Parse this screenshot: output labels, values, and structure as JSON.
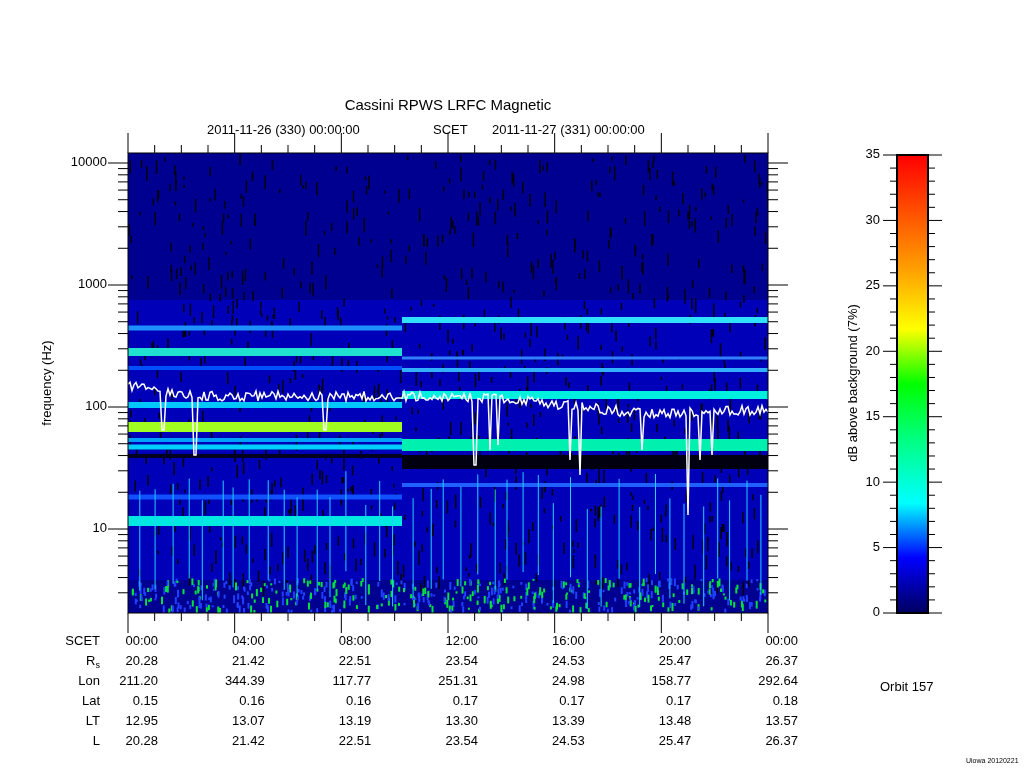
{
  "title": "Cassini RPWS LRFC Magnetic",
  "time_range": {
    "start": "2011-11-26 (330) 00:00:00",
    "label": "SCET",
    "end": "2011-11-27 (331) 00:00:00"
  },
  "y_axis": {
    "label": "frequency (Hz)",
    "ticks": [
      "10000",
      "1000",
      "100",
      "10"
    ]
  },
  "color_scale": {
    "label": "dB above background (7%)",
    "ticks": [
      "35",
      "30",
      "25",
      "20",
      "15",
      "10",
      "5",
      "0"
    ]
  },
  "ephemeris": [
    {
      "label": "SCET",
      "values": [
        "00:00",
        "04:00",
        "08:00",
        "12:00",
        "16:00",
        "20:00",
        "00:00"
      ]
    },
    {
      "label": "R$_{s}$",
      "values": [
        "20.28",
        "21.42",
        "22.51",
        "23.54",
        "24.53",
        "25.47",
        "26.37"
      ]
    },
    {
      "label": "Lon",
      "values": [
        "211.20",
        "344.39",
        "117.77",
        "251.31",
        "24.98",
        "158.77",
        "292.64"
      ]
    },
    {
      "label": "Lat",
      "values": [
        "0.15",
        "0.16",
        "0.16",
        "0.17",
        "0.17",
        "0.17",
        "0.18"
      ]
    },
    {
      "label": "LT",
      "values": [
        "12.95",
        "13.07",
        "13.19",
        "13.30",
        "13.39",
        "13.48",
        "13.57"
      ]
    },
    {
      "label": "L",
      "values": [
        "20.28",
        "21.42",
        "22.51",
        "23.54",
        "24.53",
        "25.47",
        "26.37"
      ]
    }
  ],
  "orbit": "Orbit 157",
  "credit": "Uiowa 20120221"
}
